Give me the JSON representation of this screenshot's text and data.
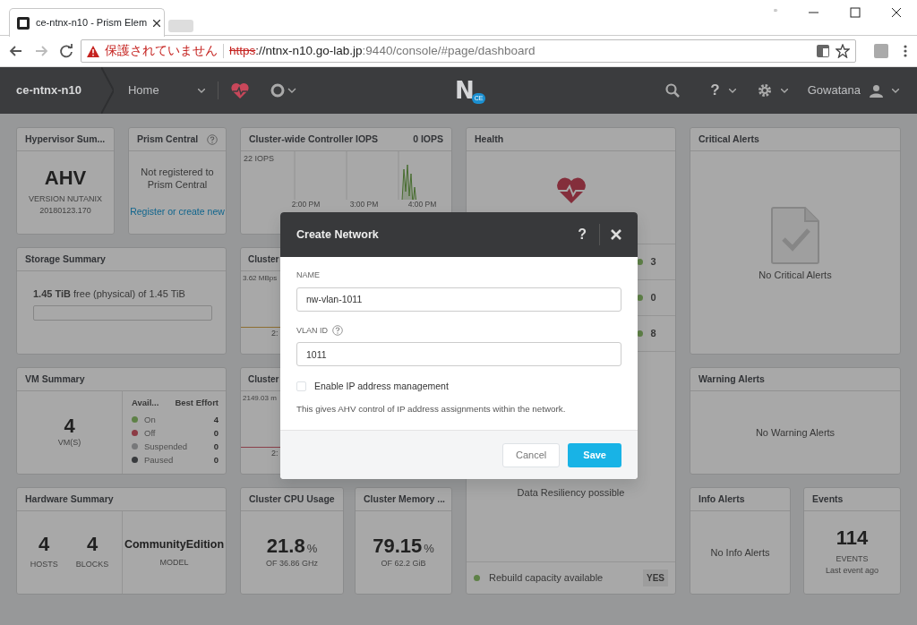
{
  "browser": {
    "tab_title": "ce-ntnx-n10 - Prism Elem",
    "security_warning": "保護されていません",
    "url_scheme": "https",
    "url_host": "://ntnx-n10.go-lab.jp",
    "url_path": ":9440/console/#page/dashboard"
  },
  "navbar": {
    "cluster_name": "ce-ntnx-n10",
    "menu": "Home",
    "logo_letter": "N",
    "logo_badge": "CE",
    "help": "?",
    "user": "Gowatana"
  },
  "widgets": {
    "hypervisor_summary": {
      "title": "Hypervisor Sum...",
      "name": "AHV",
      "version": "VERSION NUTANIX",
      "build": "20180123.170"
    },
    "prism_central": {
      "title": "Prism Central",
      "message": "Not registered to Prism Central",
      "link": "Register or create new"
    },
    "controller_iops": {
      "title": "Cluster-wide Controller IOPS",
      "reading": "0 IOPS",
      "max_label": "22 IOPS",
      "time_labels": [
        "2:00 PM",
        "3:00 PM",
        "4:00 PM"
      ]
    },
    "health": {
      "title": "Health",
      "rows": [
        {
          "value": "3",
          "color": "#5e8147"
        },
        {
          "value": "0",
          "color": "#5e8147"
        },
        {
          "value": "8",
          "color": "#5e8147"
        }
      ],
      "resiliency": "Data Resiliency possible",
      "rebuild": {
        "label": "Rebuild capacity available",
        "value": "YES",
        "color": "#5e8147"
      }
    },
    "critical_alerts": {
      "title": "Critical Alerts",
      "message": "No Critical Alerts"
    },
    "storage_summary": {
      "title": "Storage Summary",
      "text": "**1.45 TiB** free (physical) of 1.45 TiB",
      "level": 0
    },
    "cluster_chart_2": {
      "title": "Cluster",
      "max_label": "3.62 MBps",
      "time_label": "2:"
    },
    "warning_alerts": {
      "title": "Warning Alerts",
      "message": "No Warning Alerts"
    },
    "vm_summary": {
      "title": "VM Summary",
      "count": "4",
      "unit": "VM(S)",
      "columns": [
        "Avail...",
        "Best Effort"
      ],
      "rows": [
        {
          "label": "On",
          "value": "4",
          "color": "#5e8147"
        },
        {
          "label": "Off",
          "value": "0",
          "color": "#8c3b45"
        },
        {
          "label": "Suspended",
          "value": "0",
          "color": "#77787a"
        },
        {
          "label": "Paused",
          "value": "0",
          "color": "#383a3d"
        }
      ]
    },
    "cluster_chart_3": {
      "title": "Cluster",
      "max_label": "2149.03 m",
      "time_label": "2:"
    },
    "hardware_summary": {
      "title": "Hardware Summary",
      "stats": [
        {
          "value": "4",
          "unit": "HOSTS"
        },
        {
          "value": "4",
          "unit": "BLOCKS"
        }
      ],
      "model": "CommunityEdition",
      "model_label": "MODEL"
    },
    "cpu_usage": {
      "title": "Cluster CPU Usage",
      "value": "21.8",
      "unit": "%",
      "total": "OF 36.86 GHz"
    },
    "memory_usage": {
      "title": "Cluster Memory ...",
      "value": "79.15",
      "unit": "%",
      "total": "OF 62.2 GiB"
    },
    "info_alerts": {
      "title": "Info Alerts",
      "message": "No Info Alerts"
    },
    "events": {
      "title": "Events",
      "count": "114",
      "unit": "EVENTS",
      "last": "Last event ago"
    }
  },
  "modal": {
    "title": "Create Network",
    "help": "?",
    "fields": [
      {
        "label": "NAME",
        "value": "nw-vlan-1011",
        "help": false
      },
      {
        "label": "VLAN ID",
        "value": "1011",
        "help": true
      }
    ],
    "checkbox": {
      "label": "Enable IP address management",
      "checked": false
    },
    "hint": "This gives AHV control of IP address assignments within the network.",
    "buttons": [
      {
        "label": "Cancel",
        "kind": "secondary"
      },
      {
        "label": "Save",
        "kind": "primary"
      }
    ]
  }
}
